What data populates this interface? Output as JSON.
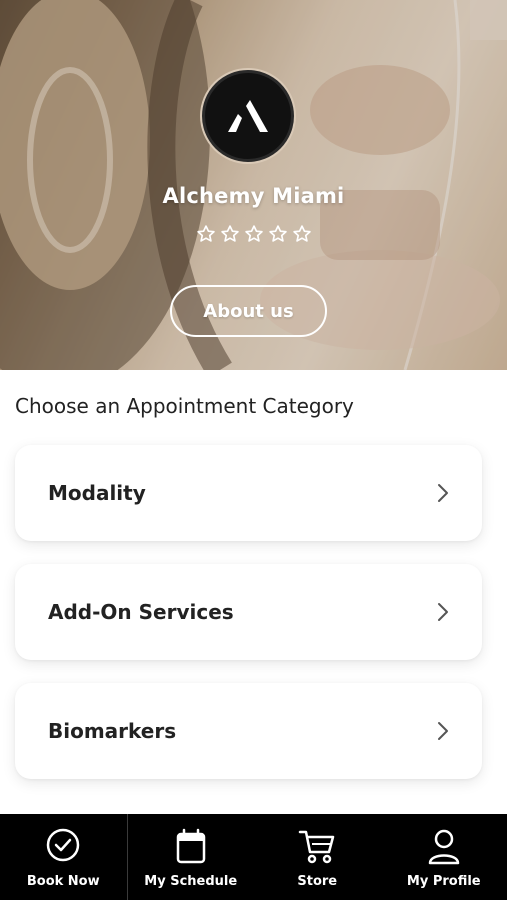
{
  "header": {
    "studio_name": "Alchemy Miami",
    "rating_stars": 0,
    "star_count": 5,
    "about_label": "About us"
  },
  "main": {
    "section_title": "Choose an Appointment Category",
    "categories": [
      {
        "label": "Modality"
      },
      {
        "label": "Add-On Services"
      },
      {
        "label": "Biomarkers"
      }
    ]
  },
  "bottom_nav": {
    "items": [
      {
        "label": "Book Now",
        "icon": "check-circle-icon"
      },
      {
        "label": "My Schedule",
        "icon": "calendar-icon"
      },
      {
        "label": "Store",
        "icon": "cart-icon"
      },
      {
        "label": "My Profile",
        "icon": "user-icon"
      }
    ]
  },
  "colors": {
    "nav_background": "#000000",
    "text_primary": "#222222",
    "card_background": "#ffffff"
  }
}
